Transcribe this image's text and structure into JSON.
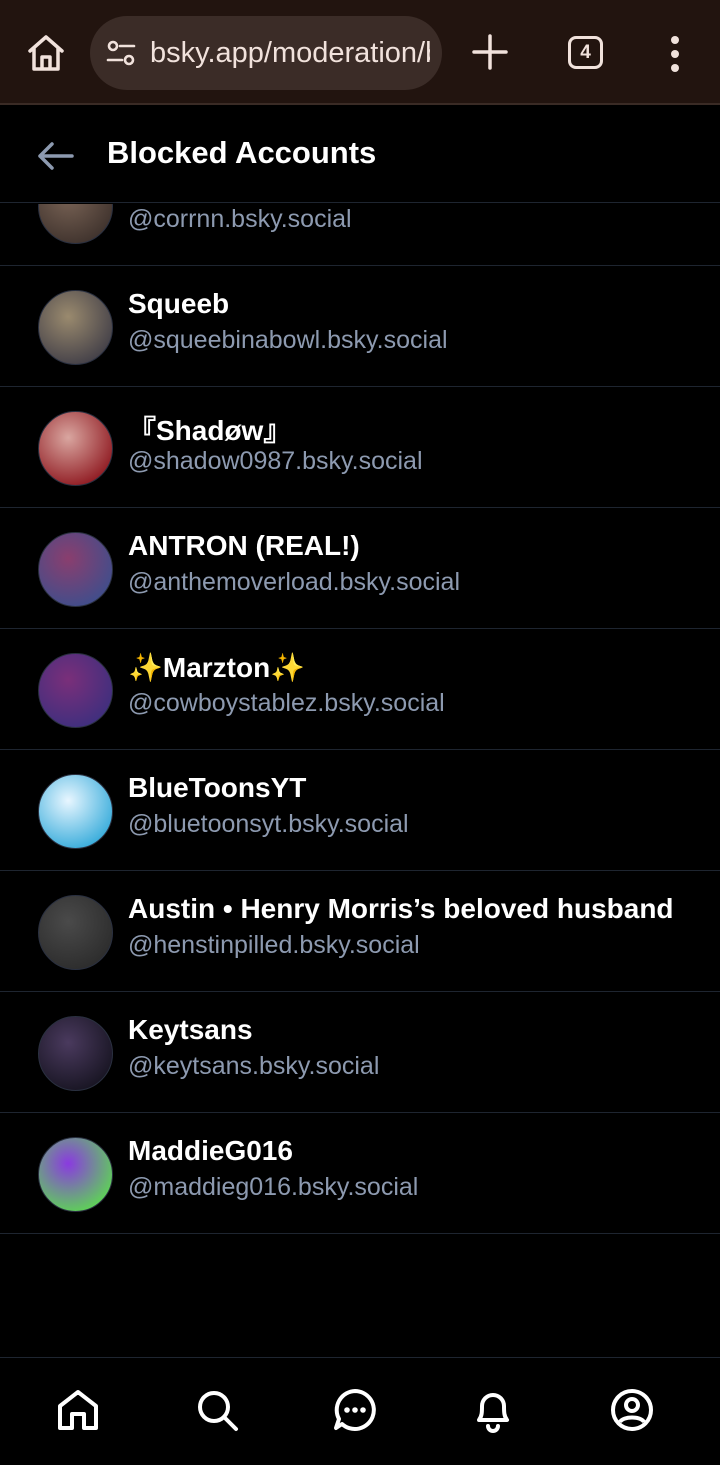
{
  "browser": {
    "url": "bsky.app/moderation/blocked-accounts",
    "tab_count": "4"
  },
  "header": {
    "title": "Blocked Accounts"
  },
  "accounts": [
    {
      "name": "",
      "handle": "@corrnn.bsky.social",
      "avatar_colors": [
        "#7a6456",
        "#3b2f2a"
      ]
    },
    {
      "name": "Squeeb",
      "handle": "@squeebinabowl.bsky.social",
      "avatar_colors": [
        "#9a8a6e",
        "#3c3a45"
      ]
    },
    {
      "name": "『Shadøw』",
      "handle": "@shadow0987.bsky.social",
      "avatar_colors": [
        "#d9a6a0",
        "#8a1018"
      ]
    },
    {
      "name": "ANTRON (REAL!)",
      "handle": "@anthemoverload.bsky.social",
      "avatar_colors": [
        "#8a3e6e",
        "#3a4f8e"
      ]
    },
    {
      "name": "✨Marzton✨",
      "handle": "@cowboystablez.bsky.social",
      "avatar_colors": [
        "#7a2f7a",
        "#3a2f7e"
      ]
    },
    {
      "name": "BlueToonsYT",
      "handle": "@bluetoonsyt.bsky.social",
      "avatar_colors": [
        "#e8f6ff",
        "#2aa6d8"
      ]
    },
    {
      "name": "Austin • Henry Morris’s beloved husband",
      "handle": "@henstinpilled.bsky.social",
      "avatar_colors": [
        "#4a4a4a",
        "#2a2a2a"
      ]
    },
    {
      "name": "Keytsans",
      "handle": "@keytsans.bsky.social",
      "avatar_colors": [
        "#4a3a5e",
        "#14121e"
      ]
    },
    {
      "name": "MaddieG016",
      "handle": "@maddieg016.bsky.social",
      "avatar_colors": [
        "#8a3ae0",
        "#5ae04a"
      ]
    }
  ],
  "nav": [
    "home-icon",
    "search-icon",
    "chat-icon",
    "notifications-icon",
    "profile-icon"
  ]
}
